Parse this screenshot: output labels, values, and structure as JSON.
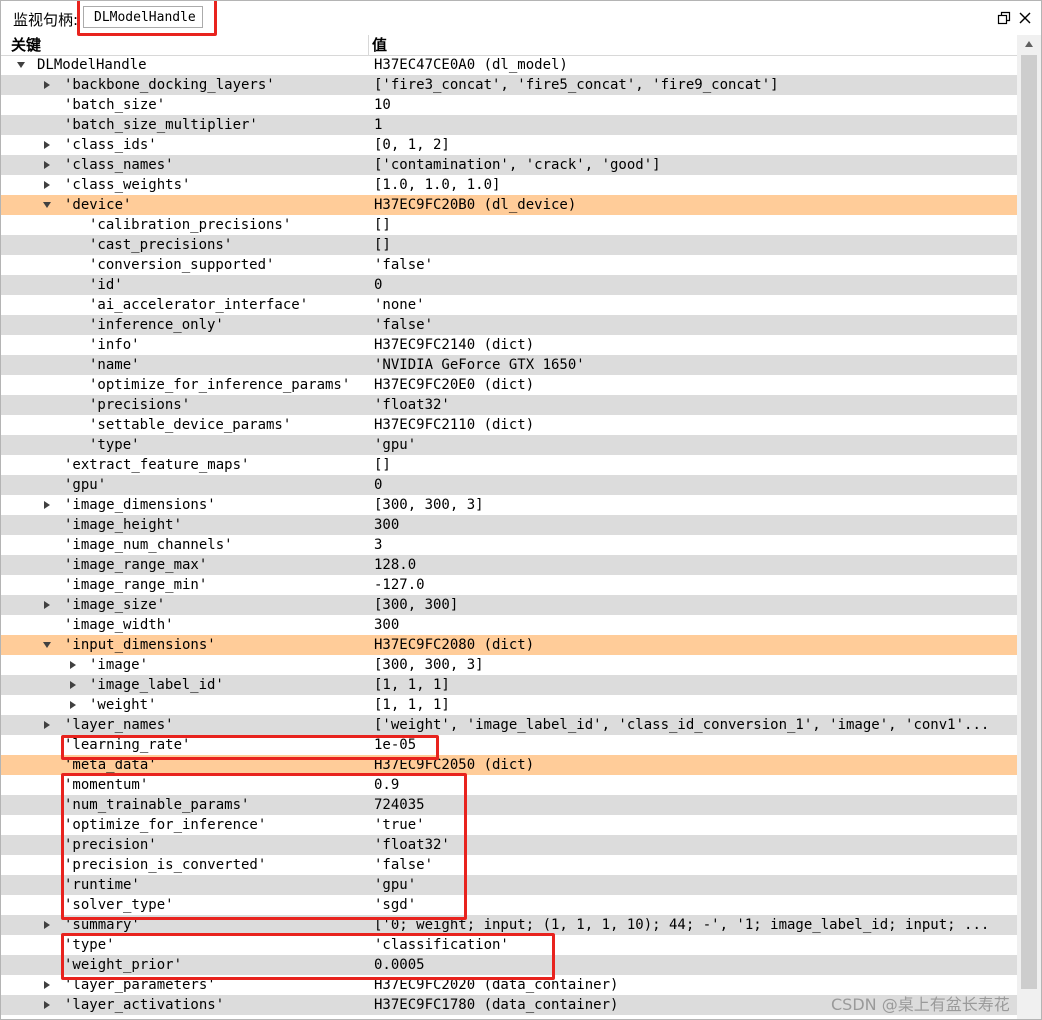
{
  "window": {
    "title_label": "监视句柄:",
    "handle_value": "DLModelHandle",
    "restore_icon": "restore-window-icon",
    "close_icon": "close-icon"
  },
  "columns": {
    "key": "关键",
    "value": "值"
  },
  "rows": [
    {
      "k": "DLModelHandle",
      "v": "H37EC47CE0A0 (dl_model)",
      "lvl": 0,
      "exp": "down",
      "bg": "w"
    },
    {
      "k": "'backbone_docking_layers'",
      "v": "['fire3_concat', 'fire5_concat', 'fire9_concat']",
      "lvl": 1,
      "exp": "right",
      "bg": "g"
    },
    {
      "k": "'batch_size'",
      "v": "10",
      "lvl": 1,
      "exp": "",
      "bg": "w"
    },
    {
      "k": "'batch_size_multiplier'",
      "v": "1",
      "lvl": 1,
      "exp": "",
      "bg": "g"
    },
    {
      "k": "'class_ids'",
      "v": "[0, 1, 2]",
      "lvl": 1,
      "exp": "right",
      "bg": "w"
    },
    {
      "k": "'class_names'",
      "v": "['contamination', 'crack', 'good']",
      "lvl": 1,
      "exp": "right",
      "bg": "g"
    },
    {
      "k": "'class_weights'",
      "v": "[1.0, 1.0, 1.0]",
      "lvl": 1,
      "exp": "right",
      "bg": "w"
    },
    {
      "k": "'device'",
      "v": "H37EC9FC20B0 (dl_device)",
      "lvl": 1,
      "exp": "down",
      "bg": "h"
    },
    {
      "k": "'calibration_precisions'",
      "v": "[]",
      "lvl": 2,
      "exp": "",
      "bg": "w"
    },
    {
      "k": "'cast_precisions'",
      "v": "[]",
      "lvl": 2,
      "exp": "",
      "bg": "g"
    },
    {
      "k": "'conversion_supported'",
      "v": "'false'",
      "lvl": 2,
      "exp": "",
      "bg": "w"
    },
    {
      "k": "'id'",
      "v": "0",
      "lvl": 2,
      "exp": "",
      "bg": "g"
    },
    {
      "k": "'ai_accelerator_interface'",
      "v": "'none'",
      "lvl": 2,
      "exp": "",
      "bg": "w"
    },
    {
      "k": "'inference_only'",
      "v": "'false'",
      "lvl": 2,
      "exp": "",
      "bg": "g"
    },
    {
      "k": "'info'",
      "v": "H37EC9FC2140 (dict)",
      "lvl": 2,
      "exp": "",
      "bg": "w"
    },
    {
      "k": "'name'",
      "v": "'NVIDIA GeForce GTX 1650'",
      "lvl": 2,
      "exp": "",
      "bg": "g"
    },
    {
      "k": "'optimize_for_inference_params'",
      "v": "H37EC9FC20E0 (dict)",
      "lvl": 2,
      "exp": "",
      "bg": "w"
    },
    {
      "k": "'precisions'",
      "v": "'float32'",
      "lvl": 2,
      "exp": "",
      "bg": "g"
    },
    {
      "k": "'settable_device_params'",
      "v": "H37EC9FC2110 (dict)",
      "lvl": 2,
      "exp": "",
      "bg": "w"
    },
    {
      "k": "'type'",
      "v": "'gpu'",
      "lvl": 2,
      "exp": "",
      "bg": "g"
    },
    {
      "k": "'extract_feature_maps'",
      "v": "[]",
      "lvl": 1,
      "exp": "",
      "bg": "w"
    },
    {
      "k": "'gpu'",
      "v": "0",
      "lvl": 1,
      "exp": "",
      "bg": "g"
    },
    {
      "k": "'image_dimensions'",
      "v": "[300, 300, 3]",
      "lvl": 1,
      "exp": "right",
      "bg": "w"
    },
    {
      "k": "'image_height'",
      "v": "300",
      "lvl": 1,
      "exp": "",
      "bg": "g"
    },
    {
      "k": "'image_num_channels'",
      "v": "3",
      "lvl": 1,
      "exp": "",
      "bg": "w"
    },
    {
      "k": "'image_range_max'",
      "v": "128.0",
      "lvl": 1,
      "exp": "",
      "bg": "g"
    },
    {
      "k": "'image_range_min'",
      "v": "-127.0",
      "lvl": 1,
      "exp": "",
      "bg": "w"
    },
    {
      "k": "'image_size'",
      "v": "[300, 300]",
      "lvl": 1,
      "exp": "right",
      "bg": "g"
    },
    {
      "k": "'image_width'",
      "v": "300",
      "lvl": 1,
      "exp": "",
      "bg": "w"
    },
    {
      "k": "'input_dimensions'",
      "v": "H37EC9FC2080 (dict)",
      "lvl": 1,
      "exp": "down",
      "bg": "h"
    },
    {
      "k": "'image'",
      "v": "[300, 300, 3]",
      "lvl": 2,
      "exp": "right",
      "bg": "w"
    },
    {
      "k": "'image_label_id'",
      "v": "[1, 1, 1]",
      "lvl": 2,
      "exp": "right",
      "bg": "g"
    },
    {
      "k": "'weight'",
      "v": "[1, 1, 1]",
      "lvl": 2,
      "exp": "right",
      "bg": "w"
    },
    {
      "k": "'layer_names'",
      "v": "['weight', 'image_label_id', 'class_id_conversion_1', 'image', 'conv1'...",
      "lvl": 1,
      "exp": "right",
      "bg": "g"
    },
    {
      "k": "'learning_rate'",
      "v": "1e-05",
      "lvl": 1,
      "exp": "",
      "bg": "w"
    },
    {
      "k": "'meta_data'",
      "v": "H37EC9FC2050 (dict)",
      "lvl": 1,
      "exp": "",
      "bg": "h"
    },
    {
      "k": "'momentum'",
      "v": "0.9",
      "lvl": 1,
      "exp": "",
      "bg": "w"
    },
    {
      "k": "'num_trainable_params'",
      "v": "724035",
      "lvl": 1,
      "exp": "",
      "bg": "g"
    },
    {
      "k": "'optimize_for_inference'",
      "v": "'true'",
      "lvl": 1,
      "exp": "",
      "bg": "w"
    },
    {
      "k": "'precision'",
      "v": "'float32'",
      "lvl": 1,
      "exp": "",
      "bg": "g"
    },
    {
      "k": "'precision_is_converted'",
      "v": "'false'",
      "lvl": 1,
      "exp": "",
      "bg": "w"
    },
    {
      "k": "'runtime'",
      "v": "'gpu'",
      "lvl": 1,
      "exp": "",
      "bg": "g"
    },
    {
      "k": "'solver_type'",
      "v": "'sgd'",
      "lvl": 1,
      "exp": "",
      "bg": "w"
    },
    {
      "k": "'summary'",
      "v": "['0; weight; input; (1, 1, 1, 10); 44; -', '1; image_label_id; input; ...",
      "lvl": 1,
      "exp": "right",
      "bg": "g"
    },
    {
      "k": "'type'",
      "v": "'classification'",
      "lvl": 1,
      "exp": "",
      "bg": "w"
    },
    {
      "k": "'weight_prior'",
      "v": "0.0005",
      "lvl": 1,
      "exp": "",
      "bg": "g"
    },
    {
      "k": "'layer_parameters'",
      "v": "H37EC9FC2020 (data_container)",
      "lvl": 1,
      "exp": "right",
      "bg": "w"
    },
    {
      "k": "'layer_activations'",
      "v": "H37EC9FC1780 (data_container)",
      "lvl": 1,
      "exp": "right",
      "bg": "g"
    }
  ],
  "colors": {
    "row_gray": "#dcdcdc",
    "row_highlight": "#ffcc99",
    "annotation_red": "#e8231e"
  },
  "watermark": "CSDN @桌上有盆长寿花"
}
